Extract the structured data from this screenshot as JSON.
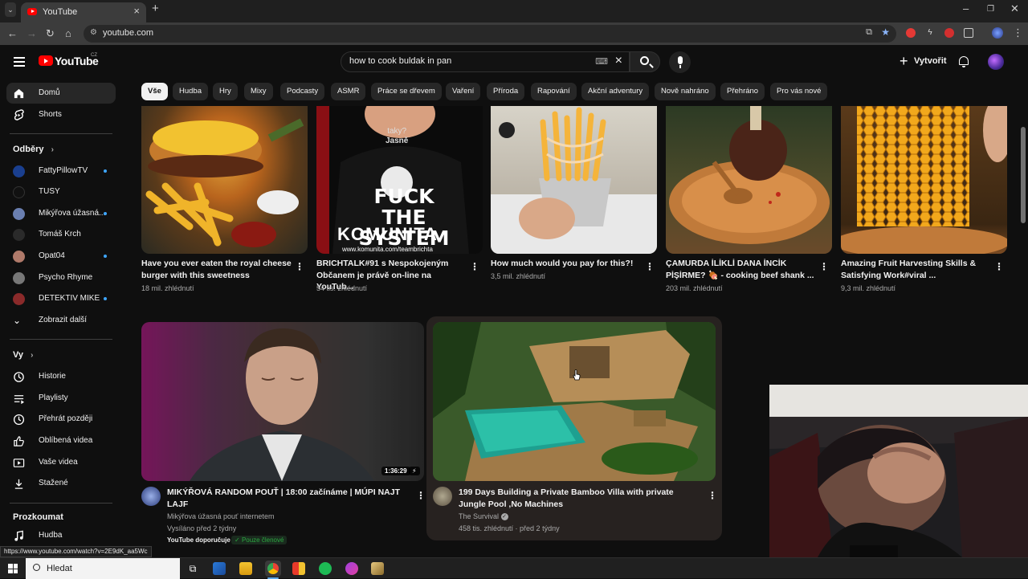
{
  "browser": {
    "tab_title": "YouTube",
    "url": "youtube.com",
    "status_link": "https://www.youtube.com/watch?v=2E9dK_aa5Wc"
  },
  "header": {
    "logo_text": "YouTube",
    "region": "CZ",
    "search_value": "how to cook buldak in pan",
    "create_label": "Vytvořit"
  },
  "sidebar": {
    "main": [
      {
        "label": "Domů",
        "icon": "home-icon"
      },
      {
        "label": "Shorts",
        "icon": "shorts-icon"
      }
    ],
    "subs_title": "Odběry",
    "subs": [
      {
        "label": "FattyPillowTV",
        "dot": true,
        "color": "#1a3f8f"
      },
      {
        "label": "TUSY",
        "dot": false,
        "color": "#111111"
      },
      {
        "label": "Mikýřova úžasná...",
        "dot": true,
        "color": "#6a7fb0"
      },
      {
        "label": "Tomáš Krch",
        "dot": false,
        "color": "#2a2a2a"
      },
      {
        "label": "Opat04",
        "dot": true,
        "color": "#b07a6a"
      },
      {
        "label": "Psycho Rhyme",
        "dot": false,
        "color": "#777777"
      },
      {
        "label": "DETEKTIV MIKE",
        "dot": true,
        "color": "#8a2a2a"
      }
    ],
    "show_more": "Zobrazit další",
    "you_title": "Vy",
    "you": [
      {
        "label": "Historie",
        "icon": "history-icon"
      },
      {
        "label": "Playlisty",
        "icon": "playlist-icon"
      },
      {
        "label": "Přehrát později",
        "icon": "watch-later-icon"
      },
      {
        "label": "Oblíbená videa",
        "icon": "like-icon"
      },
      {
        "label": "Vaše videa",
        "icon": "your-videos-icon"
      },
      {
        "label": "Stažené",
        "icon": "download-icon"
      }
    ],
    "explore_title": "Prozkoumat",
    "explore": [
      {
        "label": "Hudba",
        "icon": "music-icon"
      }
    ]
  },
  "chips": [
    "Vše",
    "Hudba",
    "Hry",
    "Mixy",
    "Podcasty",
    "ASMR",
    "Práce se dřevem",
    "Vaření",
    "Příroda",
    "Rapování",
    "Akční adventury",
    "Nově nahráno",
    "Přehráno",
    "Pro vás nové"
  ],
  "row1": [
    {
      "title": "Have you ever eaten the royal cheese burger with this sweetness",
      "meta": "18 mil. zhlédnutí"
    },
    {
      "title": "BRICHTALK#91 s Nespokojeným Občanem je právě on-line na YouTub...",
      "meta": "54 tis. zhlédnutí",
      "thumb_text_1": "taky?",
      "thumb_text_2": "Jasně",
      "thumb_text_3": "FUCK THE SYSTEM",
      "thumb_text_4": "KOMUNITA",
      "thumb_text_5": "www.komunita.com/teambrichta"
    },
    {
      "title": "How much would you pay for this?!",
      "meta": "3,5 mil. zhlédnutí"
    },
    {
      "title": "ÇAMURDA İLİKLİ DANA İNCİK PİŞİRME? 🍖 - cooking beef shank ...",
      "meta": "203 mil. zhlédnutí"
    },
    {
      "title": "Amazing Fruit Harvesting Skills & Satisfying Work#viral ...",
      "meta": "9,3 mil. zhlédnutí"
    }
  ],
  "row2": [
    {
      "title": "MIKÝŘOVÁ RANDOM POUŤ  | 18:00 začínáme | MÚPI NAJT LAJF",
      "channel": "Mikýřova úžasná pouť internetem",
      "meta": "Vysíláno před 2 týdny",
      "duration": "1:36:29",
      "badge1": "YouTube doporučuje",
      "badge2": "Pouze členové"
    },
    {
      "title": "199 Days Building a Private Bamboo Villa with private Jungle Pool ,No Machines",
      "channel": "The Survival",
      "meta": "458 tis. zhlédnutí · před 2 týdny"
    }
  ],
  "taskbar": {
    "search_label": "Hledat"
  },
  "colors": {
    "accent": "#ff0000",
    "link_blue": "#3ea6ff"
  }
}
